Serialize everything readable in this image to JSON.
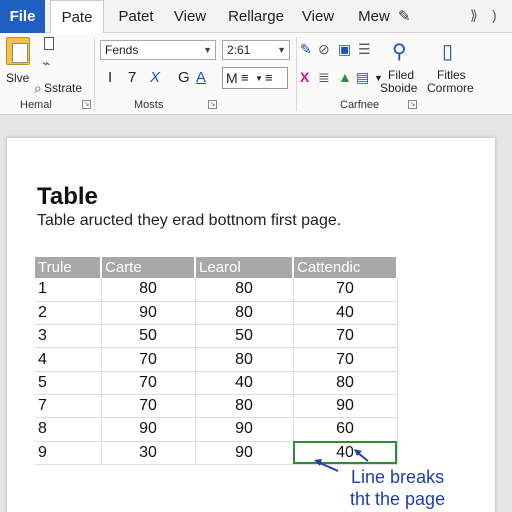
{
  "tabs": {
    "file": "File",
    "items": [
      "Pate",
      "Patet",
      "View",
      "Rellarge",
      "View",
      "Mew"
    ]
  },
  "ribbon": {
    "clipboard": {
      "save_label": "Slve",
      "sstrate_label": "Sstrate",
      "group_label": "Hemal"
    },
    "font": {
      "font_name": "Fends",
      "font_size": "2:61",
      "bold": "I",
      "italic": "7",
      "strike": "X",
      "grow": "G",
      "color": "A",
      "group_label": "Mosts"
    },
    "editing": {
      "filed_label": "Filed",
      "sboide_label": "Sboide",
      "fitles_label": "Fitles",
      "cormore_label": "Cormore",
      "group_label": "Carfnee"
    }
  },
  "document": {
    "title": "Table",
    "subtitle": "Table aructed they erad bottnom first page.",
    "table": {
      "headers": [
        "Trule",
        "Carte",
        "Learol",
        "Cattendic"
      ],
      "rows": [
        [
          "1",
          "80",
          "80",
          "70"
        ],
        [
          "2",
          "90",
          "80",
          "40"
        ],
        [
          "3",
          "50",
          "50",
          "70"
        ],
        [
          "4",
          "70",
          "80",
          "70"
        ],
        [
          "5",
          "70",
          "40",
          "80"
        ],
        [
          "7",
          "70",
          "80",
          "90"
        ],
        [
          "8",
          "90",
          "90",
          "60"
        ],
        [
          "9",
          "30",
          "90",
          "40"
        ]
      ]
    },
    "annotation": {
      "line1": "Line breaks",
      "line2": "tht the page"
    }
  },
  "colors": {
    "file_tab": "#1f5fbf",
    "header_fill": "#a8a8a8",
    "selection": "#2f8a3a",
    "annotation": "#1f3fa8"
  }
}
